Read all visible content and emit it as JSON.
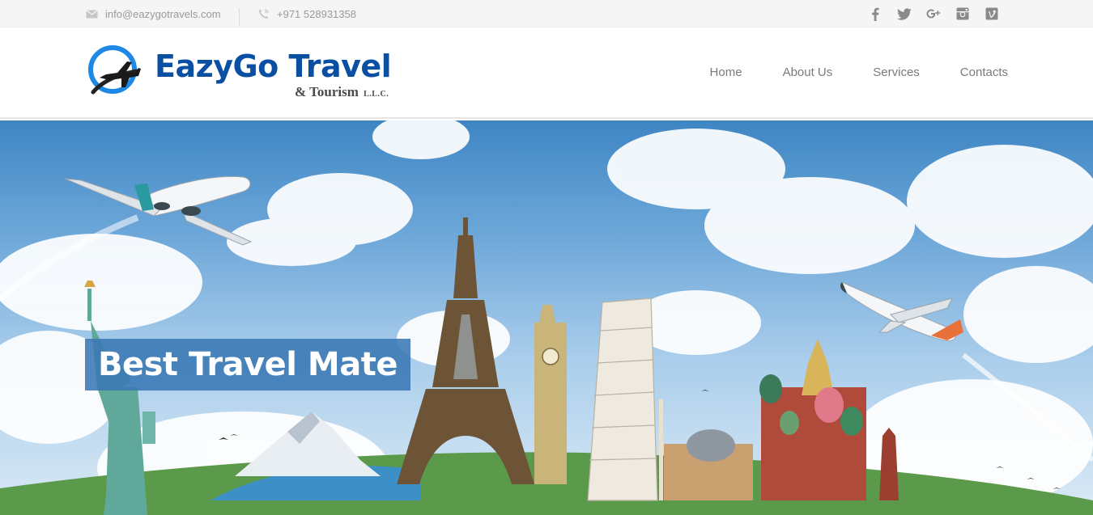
{
  "topbar": {
    "email": "info@eazygotravels.com",
    "phone": "+971 528931358",
    "socials": [
      "facebook-icon",
      "twitter-icon",
      "google-plus-icon",
      "instagram-icon",
      "vimeo-icon"
    ]
  },
  "brand": {
    "title": "EazyGo Travel",
    "subtitle": "& Tourism",
    "suffix": "L.L.C.",
    "colors": {
      "primary": "#0b4fa3",
      "accent": "#1e88e5"
    }
  },
  "nav": {
    "items": [
      "Home",
      "About Us",
      "Services",
      "Contacts"
    ]
  },
  "hero": {
    "headline": "Best Travel Mate",
    "banner_color": "#3a78b4"
  }
}
